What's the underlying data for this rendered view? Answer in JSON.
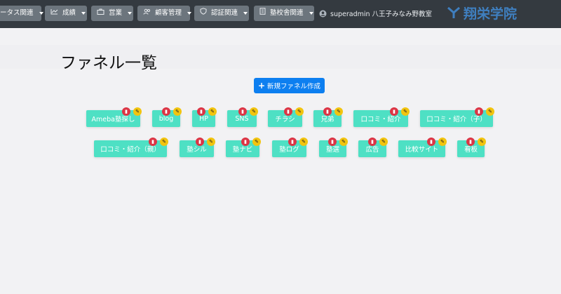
{
  "nav": {
    "items": [
      {
        "label": "ータス関連",
        "icon": ""
      },
      {
        "label": "成績",
        "icon": "chart-line-icon"
      },
      {
        "label": "営業",
        "icon": "briefcase-icon"
      },
      {
        "label": "顧客管理",
        "icon": "users-icon"
      },
      {
        "label": "認証関連",
        "icon": "shield-icon"
      },
      {
        "label": "塾校舎関連",
        "icon": "building-icon"
      }
    ],
    "user": "superadmin 八王子みなみ野教室",
    "logo": "翔栄学院"
  },
  "page": {
    "title": "ファネル一覧",
    "create_button": "新規ファネル作成"
  },
  "funnels": [
    "Ameba塾探し",
    "blog",
    "HP",
    "SNS",
    "チラシ",
    "兄弟",
    "口コミ・紹介",
    "口コミ・紹介（子）",
    "口コミ・紹介（親）",
    "塾シル",
    "塾ナビ",
    "塾ログ",
    "塾選",
    "広告",
    "比較サイト",
    "看板"
  ],
  "colors": {
    "accent": "#0d7ff0",
    "funnel": "#4ee0c4",
    "navbar": "#343a40",
    "delete": "#dc3545",
    "edit": "#f2c40f"
  }
}
